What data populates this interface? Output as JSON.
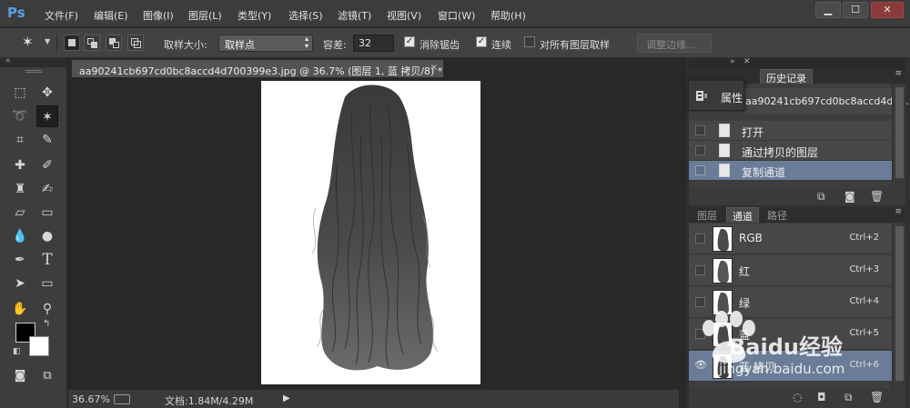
{
  "app": {
    "logo": "Ps"
  },
  "menu": [
    {
      "id": "file",
      "label": "文件(F)"
    },
    {
      "id": "edit",
      "label": "编辑(E)"
    },
    {
      "id": "image",
      "label": "图像(I)"
    },
    {
      "id": "layer",
      "label": "图层(L)"
    },
    {
      "id": "type",
      "label": "类型(Y)"
    },
    {
      "id": "select",
      "label": "选择(S)"
    },
    {
      "id": "filter",
      "label": "滤镜(T)"
    },
    {
      "id": "view",
      "label": "视图(V)"
    },
    {
      "id": "window",
      "label": "窗口(W)"
    },
    {
      "id": "help",
      "label": "帮助(H)"
    }
  ],
  "window_controls": {
    "minimize": "▁",
    "maximize": "☐",
    "close": "✕"
  },
  "options": {
    "sample_size_label": "取样大小:",
    "sample_size_value": "取样点",
    "tolerance_label": "容差:",
    "tolerance_value": "32",
    "antialias_label": "消除锯齿",
    "antialias_checked": "✓",
    "contiguous_label": "连续",
    "contiguous_checked": "✓",
    "all_layers_label": "对所有图层取样",
    "refine_edge_label": "调整边缘..."
  },
  "document": {
    "tab_title": "aa90241cb697cd0bc8accd4d700399e3.jpg @ 36.7% (图层 1, 蓝 拷贝/8) *",
    "close": "×",
    "zoom": "36.67%",
    "doc_size": "文档:1.84M/4.29M"
  },
  "properties_popup": {
    "label": "属性"
  },
  "history_panel": {
    "tab_label": "历史记录",
    "snapshot_label": "aa90241cb697cd0bc8accd4d70...",
    "items": [
      {
        "label": "打开",
        "selected": false
      },
      {
        "label": "通过拷贝的图层",
        "selected": false
      },
      {
        "label": "复制通道",
        "selected": true
      }
    ]
  },
  "channels_panel": {
    "tabs": [
      {
        "label": "图层",
        "active": false
      },
      {
        "label": "通道",
        "active": true
      },
      {
        "label": "路径",
        "active": false
      }
    ],
    "channels": [
      {
        "name": "RGB",
        "shortcut": "Ctrl+2",
        "selected": false
      },
      {
        "name": "红",
        "shortcut": "Ctrl+3",
        "selected": false
      },
      {
        "name": "绿",
        "shortcut": "Ctrl+4",
        "selected": false
      },
      {
        "name": "蓝",
        "shortcut": "Ctrl+5",
        "selected": false
      },
      {
        "name": "蓝 拷贝",
        "shortcut": "Ctrl+6",
        "selected": true
      }
    ]
  },
  "watermark": {
    "brand": "Baidu经验",
    "url": "jingyan.baidu.com"
  },
  "colors": {
    "foreground": "#000000",
    "background": "#ffffff",
    "selection": "#6a7c97",
    "logo": "#5aa0e6"
  }
}
